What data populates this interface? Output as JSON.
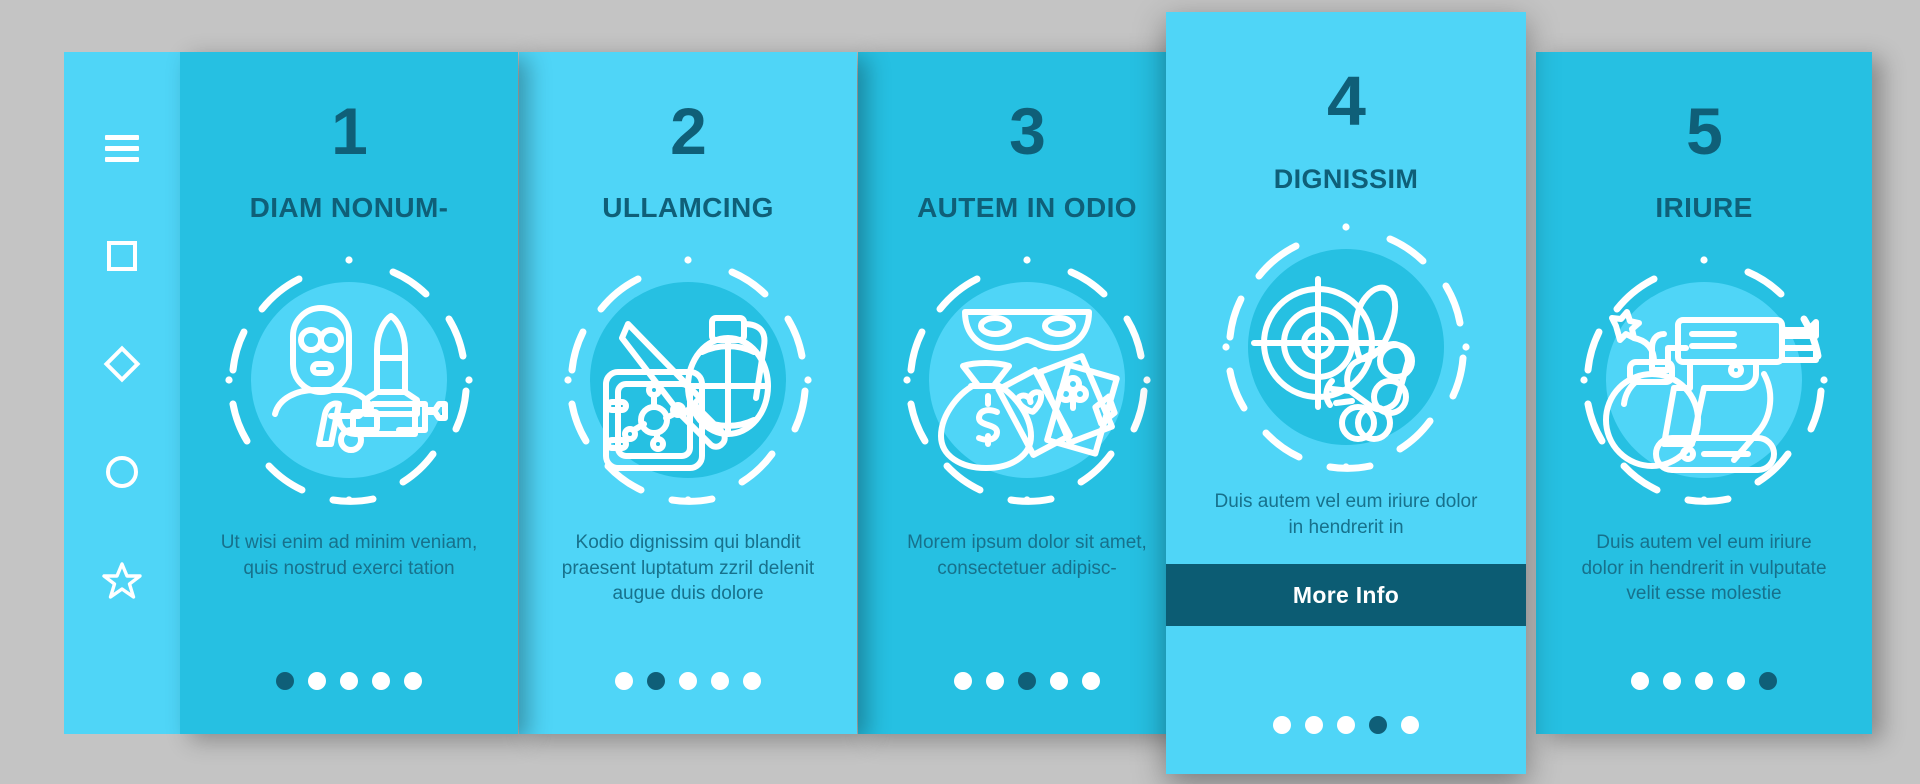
{
  "theme": {
    "bg": "#c4c4c4",
    "card_dark": "#26c0e2",
    "card_light": "#4fd5f7",
    "accent_dark": "#0f5f78",
    "cta_bg": "#0c5c73",
    "line_white": "#ffffff",
    "body_text": "#17718c"
  },
  "sidebar": {
    "items": [
      {
        "icon": "hamburger-menu-icon"
      },
      {
        "icon": "square-icon"
      },
      {
        "icon": "diamond-icon"
      },
      {
        "icon": "circle-icon"
      },
      {
        "icon": "star-icon"
      }
    ]
  },
  "cards": [
    {
      "number": "1",
      "title": "DIAM NONUM-",
      "description": "Ut wisi enim ad minim veniam, quis nostrud exerci tation",
      "icon": "masked-criminal-rocket-revolver-icon",
      "dots_total": 5,
      "dot_active": 1,
      "tone": "dark",
      "cta": null
    },
    {
      "number": "2",
      "title": "ULLAMCING",
      "description": "Kodio dignissim qui blandit praesent luptatum zzril delenit augue duis dolore",
      "icon": "knife-grenade-explosive-icon",
      "dots_total": 5,
      "dot_active": 2,
      "tone": "light",
      "cta": null
    },
    {
      "number": "3",
      "title": "AUTEM IN ODIO",
      "description": "Morem ipsum dolor sit amet, consectetuer adipisc-",
      "icon": "bandit-mask-money-bag-cards-icon",
      "dots_total": 5,
      "dot_active": 3,
      "tone": "dark",
      "cta": null
    },
    {
      "number": "4",
      "title": "DIGNISSIM",
      "description": "Duis autem vel eum iriure dolor in hendrerit in",
      "icon": "target-crosshair-bullets-icon",
      "dots_total": 5,
      "dot_active": 4,
      "tone": "light",
      "cta": "More Info"
    },
    {
      "number": "5",
      "title": "IRIURE",
      "description": "Duis autem vel eum iriure dolor in hendrerit in vulputate velit esse molestie",
      "icon": "bomb-pistol-pocketknife-icon",
      "dots_total": 5,
      "dot_active": 5,
      "tone": "dark",
      "cta": null
    }
  ]
}
